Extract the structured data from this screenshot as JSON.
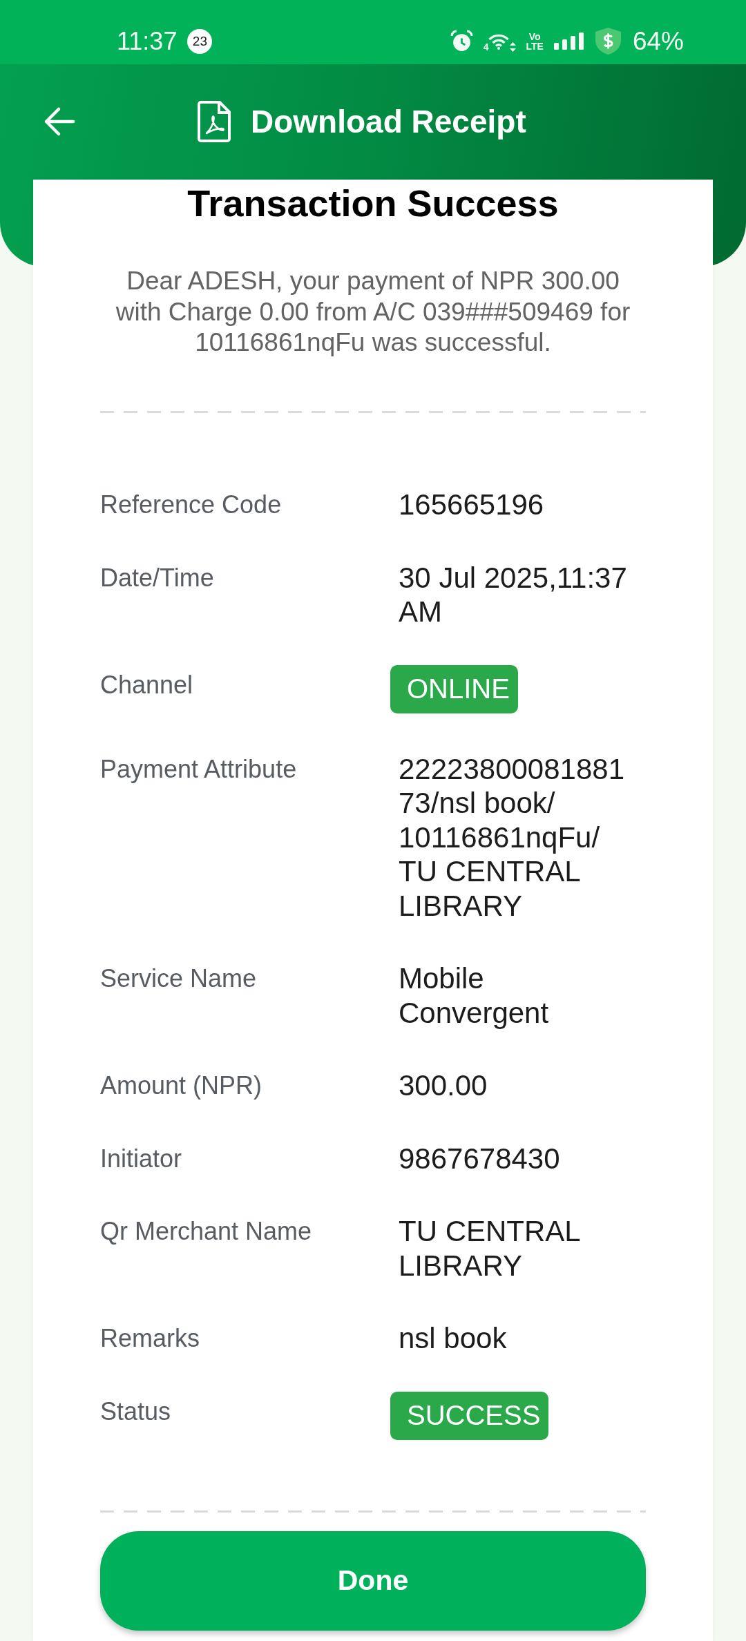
{
  "status_bar": {
    "time": "11:37",
    "notification_count": "23",
    "network_type": "4",
    "volte": "Vo LTE",
    "battery": "64%"
  },
  "header": {
    "title": "Download Receipt"
  },
  "receipt": {
    "title": "Transaction Success",
    "message": "Dear ADESH, your payment of NPR 300.00 with Charge 0.00 from A/C 039###509469 for 10116861nqFu was successful.",
    "details": [
      {
        "label": "Reference Code",
        "value": "165665196",
        "kind": "text"
      },
      {
        "label": "Date/Time",
        "value": "30 Jul 2025,11:37 AM",
        "kind": "text"
      },
      {
        "label": "Channel",
        "value": "ONLINE",
        "kind": "badge"
      },
      {
        "label": "Payment Attribute",
        "value": "2222380008188173/nsl book/10116861nqFu/TU CENTRAL LIBRARY",
        "kind": "text"
      },
      {
        "label": "Service Name",
        "value": "Mobile Convergent",
        "kind": "text"
      },
      {
        "label": "Amount (NPR)",
        "value": "300.00",
        "kind": "text"
      },
      {
        "label": "Initiator",
        "value": "9867678430",
        "kind": "text"
      },
      {
        "label": "Qr Merchant Name",
        "value": "TU CENTRAL LIBRARY",
        "kind": "text"
      },
      {
        "label": "Remarks",
        "value": "nsl book",
        "kind": "text"
      },
      {
        "label": "Status",
        "value": "SUCCESS",
        "kind": "badge"
      }
    ]
  },
  "done_button": {
    "label": "Done"
  }
}
